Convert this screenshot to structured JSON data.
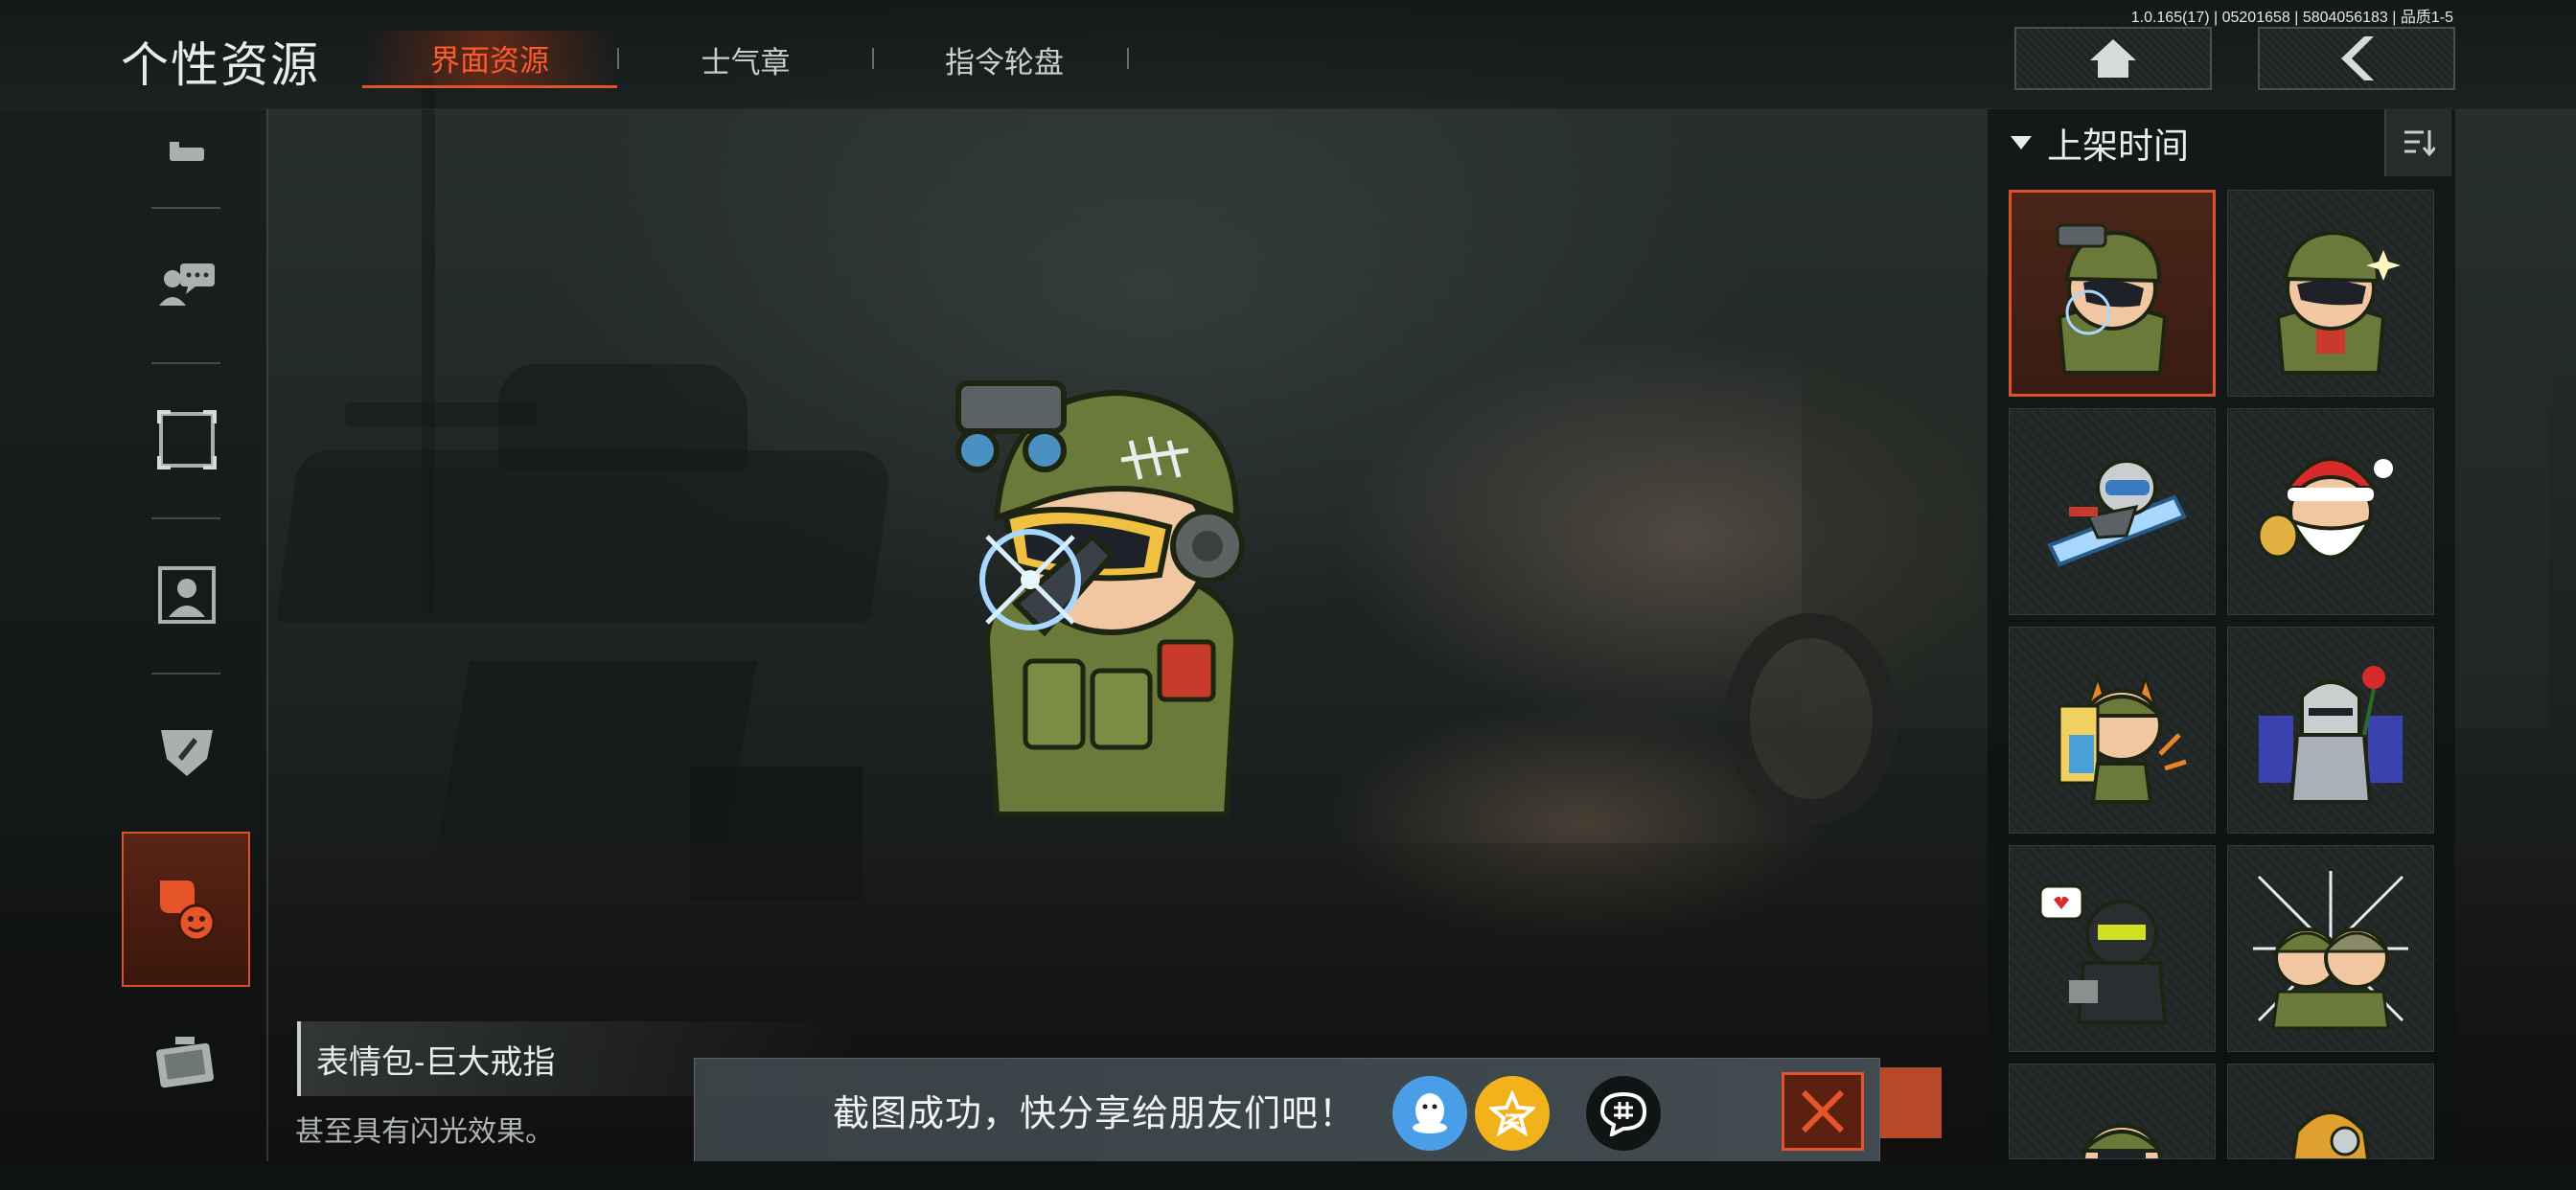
{
  "header": {
    "page_title": "个性资源",
    "version": "1.0.165(17) | 05201658 | 5804056183 | 品质1-5",
    "tabs": [
      {
        "label": "界面资源",
        "active": true
      },
      {
        "label": "士气章",
        "active": false
      },
      {
        "label": "指令轮盘",
        "active": false
      }
    ],
    "home_icon": "home-icon",
    "back_icon": "back-arrow-icon"
  },
  "sidebar": {
    "items": [
      {
        "icon": "bed-icon"
      },
      {
        "icon": "chat-person-icon"
      },
      {
        "icon": "frame-icon"
      },
      {
        "icon": "portrait-icon"
      },
      {
        "icon": "badge-icon"
      },
      {
        "icon": "sticker-emoji-icon",
        "active": true
      },
      {
        "icon": "case-icon"
      }
    ]
  },
  "preview": {
    "item_name": "表情包-巨大戒指",
    "item_desc": "甚至具有闪光效果。"
  },
  "toast": {
    "text": "截图成功，快分享给朋友们吧！",
    "share_targets": [
      "qq-icon",
      "qzone-star-icon",
      "chat-bubble-icon"
    ],
    "close_icon": "close-x-icon"
  },
  "right_panel": {
    "sort_label": "上架时间",
    "sort_icon": "sort-icon",
    "stickers": [
      {
        "name": "soldier-night-vision",
        "selected": true
      },
      {
        "name": "soldier-sparkle"
      },
      {
        "name": "soldier-ice-board"
      },
      {
        "name": "santa-soldier"
      },
      {
        "name": "fox-soldier-blonde"
      },
      {
        "name": "armored-knight-rose"
      },
      {
        "name": "dark-soldier-heart"
      },
      {
        "name": "group-soldiers"
      },
      {
        "name": "sticker-9"
      },
      {
        "name": "sticker-10"
      }
    ]
  },
  "colors": {
    "accent": "#e0542a",
    "active_tab_text": "#ff5a2a"
  }
}
